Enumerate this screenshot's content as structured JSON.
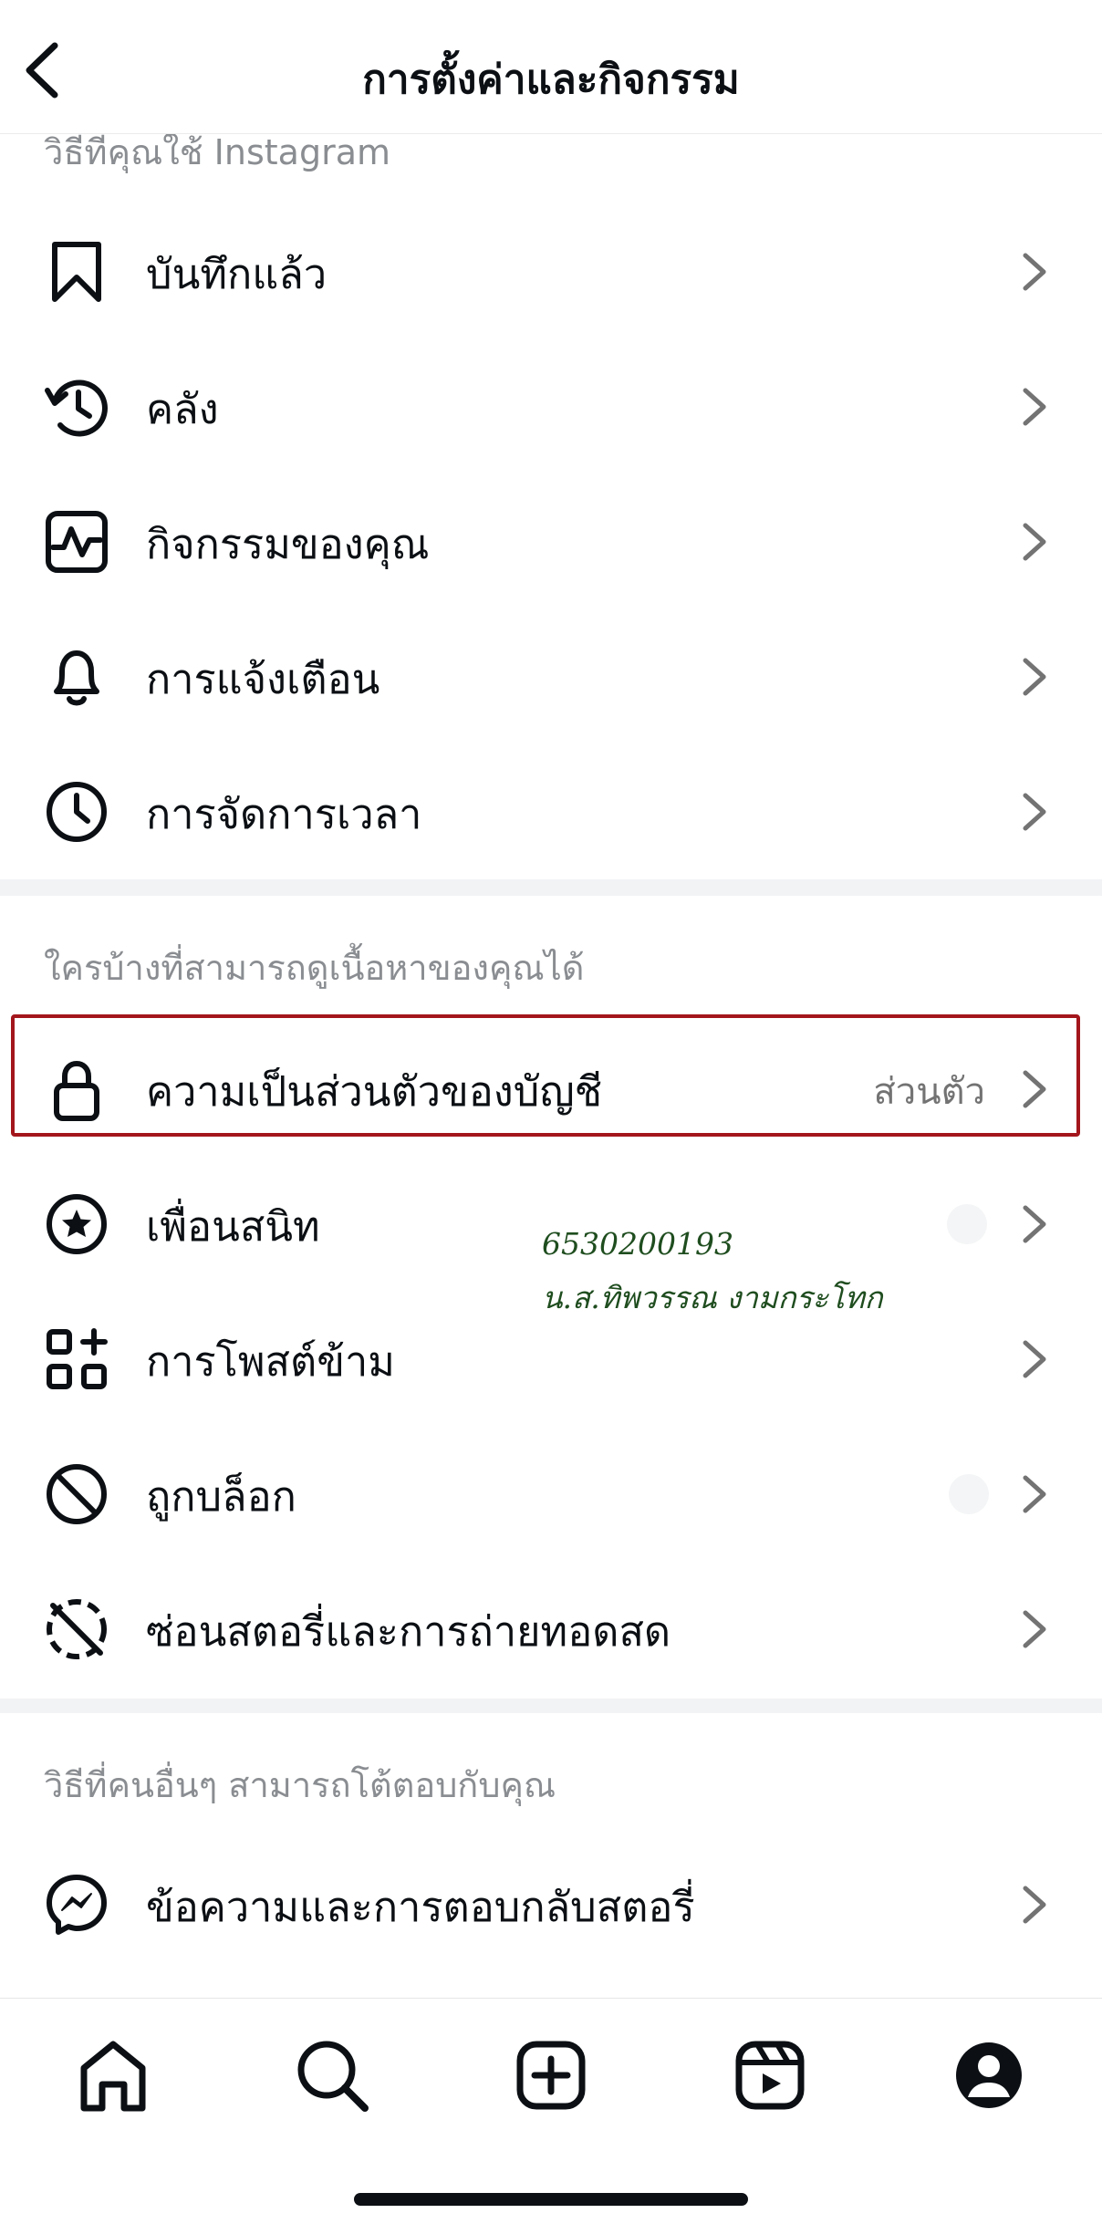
{
  "header": {
    "title": "การตั้งค่าและกิจกรรม",
    "back_icon": "chevron-left-icon"
  },
  "sections": {
    "usage": {
      "title": "วิธีที่คุณใช้ Instagram"
    },
    "visibility": {
      "title": "ใครบ้างที่สามารถดูเนื้อหาของคุณได้"
    },
    "interaction": {
      "title": "วิธีที่คนอื่นๆ สามารถโต้ตอบกับคุณ"
    }
  },
  "items": {
    "saved": {
      "label": "บันทึกแล้ว",
      "icon": "bookmark-icon"
    },
    "archive": {
      "label": "คลัง",
      "icon": "history-icon"
    },
    "activity": {
      "label": "กิจกรรมของคุณ",
      "icon": "activity-icon"
    },
    "notifications": {
      "label": "การแจ้งเตือน",
      "icon": "bell-icon"
    },
    "time": {
      "label": "การจัดการเวลา",
      "icon": "clock-icon"
    },
    "privacy": {
      "label": "ความเป็นส่วนตัวของบัญชี",
      "value": "ส่วนตัว",
      "icon": "lock-icon"
    },
    "close_friends": {
      "label": "เพื่อนสนิท",
      "icon": "star-circle-icon"
    },
    "crossposting": {
      "label": "การโพสต์ข้าม",
      "icon": "grid-plus-icon"
    },
    "blocked": {
      "label": "ถูกบล็อก",
      "icon": "blocked-icon"
    },
    "hide_story": {
      "label": "ซ่อนสตอรี่และการถ่ายทอดสด",
      "icon": "hide-story-icon"
    },
    "messages": {
      "label": "ข้อความและการตอบกลับสตอรี่",
      "icon": "messenger-icon"
    }
  },
  "annotation": {
    "line1": "6530200193",
    "line2": "น.ส.ทิพวรรณ งามกระโทก"
  },
  "tabbar": [
    "home-icon",
    "search-icon",
    "create-icon",
    "reels-icon",
    "profile-icon"
  ],
  "colors": {
    "highlight": "#a3161c",
    "secondary_text": "#8a8d91",
    "annotation_ink": "#1f4d1f"
  }
}
